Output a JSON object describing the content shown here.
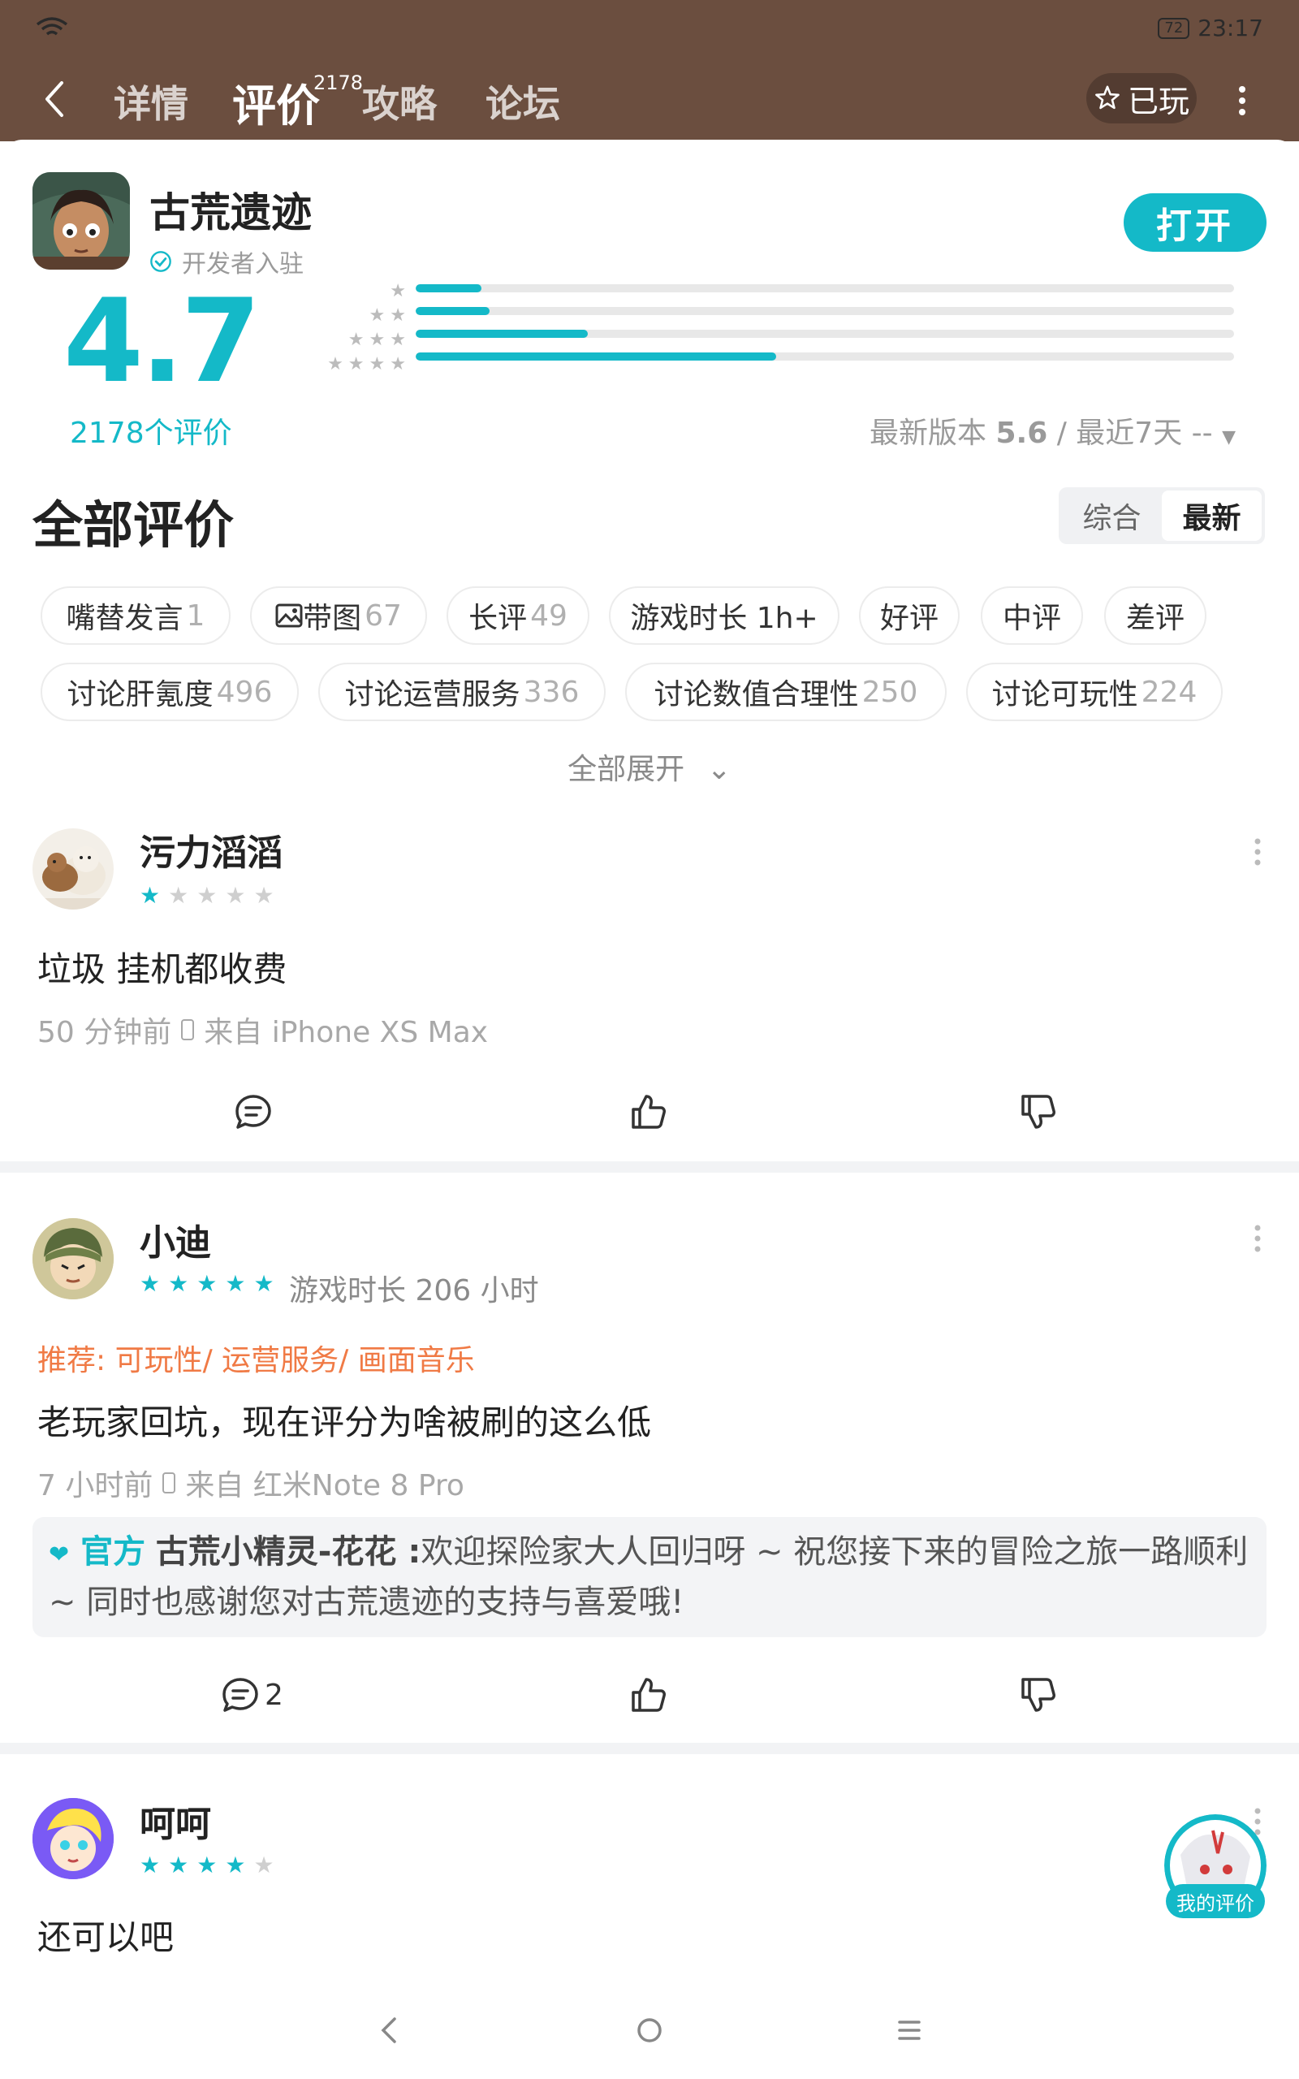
{
  "status": {
    "battery": "72",
    "time": "23:17"
  },
  "header": {
    "tabs": [
      {
        "label": "详情"
      },
      {
        "label": "评价",
        "count": "2178"
      },
      {
        "label": "攻略"
      },
      {
        "label": "论坛"
      }
    ],
    "played_label": "已玩"
  },
  "app": {
    "name": "古荒遗迹",
    "developer_badge": "开发者入驻",
    "open_label": "打开"
  },
  "rating": {
    "score": "4.7",
    "count_label": "2178个评价",
    "version_line_prefix": "最新版本",
    "version": "5.6",
    "version_line_suffix": "/ 最近7天 --",
    "distribution": [
      {
        "stars": 1,
        "fraction": 0.08
      },
      {
        "stars": 2,
        "fraction": 0.09
      },
      {
        "stars": 3,
        "fraction": 0.21
      },
      {
        "stars": 4,
        "fraction": 0.44
      }
    ]
  },
  "reviews_section": {
    "title": "全部评价",
    "sort_options": [
      "综合",
      "最新"
    ],
    "active_sort": "最新",
    "chips": [
      {
        "label": "嘴替发言",
        "num": "1"
      },
      {
        "label": "带图",
        "num": "67"
      },
      {
        "label": "长评",
        "num": "49"
      },
      {
        "label": "游戏时长 1h+",
        "num": ""
      },
      {
        "label": "好评",
        "num": ""
      },
      {
        "label": "中评",
        "num": ""
      },
      {
        "label": "差评",
        "num": ""
      },
      {
        "label": "讨论肝氪度",
        "num": "496"
      },
      {
        "label": "讨论运营服务",
        "num": "336"
      },
      {
        "label": "讨论数值合理性",
        "num": "250"
      },
      {
        "label": "讨论可玩性",
        "num": "224"
      }
    ],
    "expand_label": "全部展开"
  },
  "reviews": [
    {
      "user": "污力滔滔",
      "stars": 1,
      "text": "垃圾 挂机都收费",
      "time": "50 分钟前",
      "device": "来自 iPhone XS Max"
    },
    {
      "user": "小迪",
      "stars": 5,
      "playtime": "游戏时长 206 小时",
      "recommend": "推荐: 可玩性/ 运营服务/ 画面音乐",
      "text": "老玩家回坑，现在评分为啥被刷的这么低",
      "time": "7 小时前",
      "device": "来自 红米Note 8 Pro",
      "official_tag": "官方",
      "official_name": "古荒小精灵-花花 :",
      "official_reply": "欢迎探险家大人回归呀 ~ 祝您接下来的冒险之旅一路顺利 ~ 同时也感谢您对古荒遗迹的支持与喜爱哦!",
      "comment_count": "2"
    },
    {
      "user": "呵呵",
      "stars": 4,
      "text": "还可以吧"
    }
  ],
  "my_review_label": "我的评价",
  "colors": {
    "accent": "#14b9c8",
    "header_bg": "#6b4e3f",
    "recommend": "#f07a45"
  }
}
